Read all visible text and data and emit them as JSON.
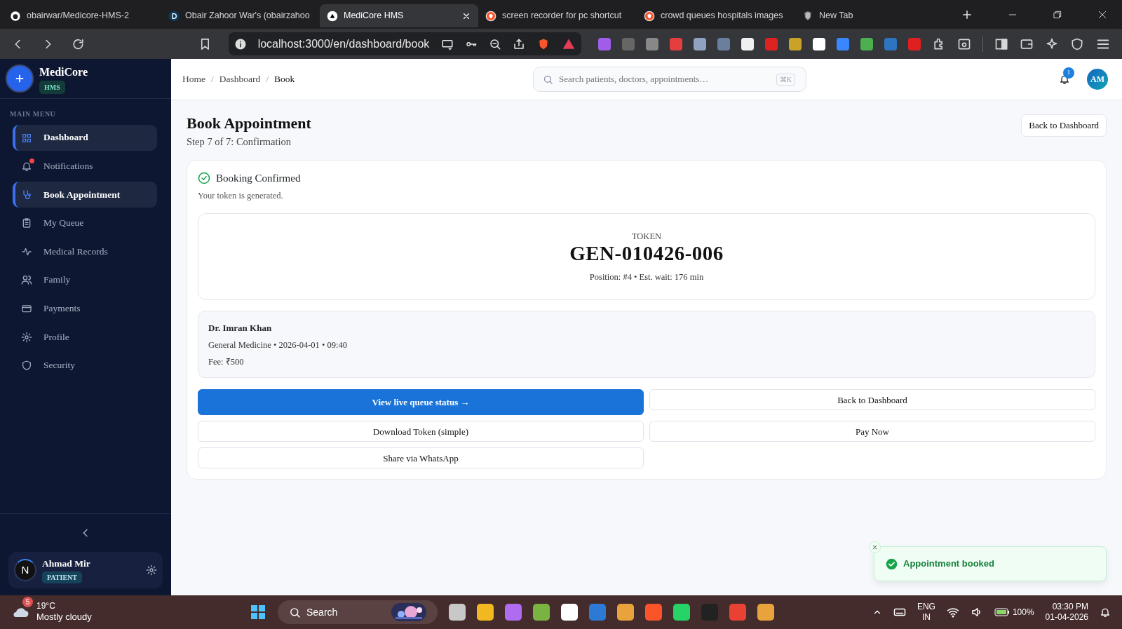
{
  "browser": {
    "tabs": [
      {
        "title": "obairwar/Medicore-HMS-2",
        "selected": false
      },
      {
        "title": "Obair Zahoor War's (obairzahoo",
        "selected": false
      },
      {
        "title": "MediCore HMS",
        "selected": true
      },
      {
        "title": "screen recorder for pc shortcut",
        "selected": false
      },
      {
        "title": "crowd queues hospitals images",
        "selected": false
      },
      {
        "title": "New Tab",
        "selected": false
      }
    ],
    "address": "localhost:3000/en/dashboard/book"
  },
  "sidebar": {
    "brand": "MediCore",
    "brand_badge": "HMS",
    "menu_heading": "MAIN MENU",
    "items": [
      {
        "label": "Dashboard",
        "selected": true,
        "dot": false
      },
      {
        "label": "Notifications",
        "selected": false,
        "dot": true
      },
      {
        "label": "Book Appointment",
        "selected": true,
        "dot": false
      },
      {
        "label": "My Queue",
        "selected": false,
        "dot": false
      },
      {
        "label": "Medical Records",
        "selected": false,
        "dot": false
      },
      {
        "label": "Family",
        "selected": false,
        "dot": false
      },
      {
        "label": "Payments",
        "selected": false,
        "dot": false
      },
      {
        "label": "Profile",
        "selected": false,
        "dot": false
      },
      {
        "label": "Security",
        "selected": false,
        "dot": false
      }
    ],
    "user": {
      "initial": "N",
      "name": "Ahmad Mir",
      "role": "PATIENT"
    }
  },
  "header": {
    "breadcrumbs": [
      "Home",
      "Dashboard",
      "Book"
    ],
    "breadcrumb_separator": "/",
    "search": {
      "placeholder": "Search patients, doctors, appointments…"
    },
    "shortcut": "⌘K",
    "notification_count": "1",
    "avatar": "AM"
  },
  "page": {
    "title": "Book Appointment",
    "subtitle": "Step 7 of 7: Confirmation",
    "back_button": "Back to Dashboard"
  },
  "confirmation": {
    "title": "Booking Confirmed",
    "text": "Your token is generated.",
    "token": {
      "label": "TOKEN",
      "code": "GEN-010426-006",
      "meta": "Position: #4 • Est. wait: 176 min"
    },
    "doctor": {
      "name": "Dr. Imran Khan",
      "details": "General Medicine • 2026-04-01 • 09:40",
      "fee": "Fee: ₹500"
    },
    "actions": [
      {
        "label": "View live queue status →",
        "kind": "primary"
      },
      {
        "label": "Back to Dashboard",
        "kind": "outline"
      },
      {
        "label": "Download Token (simple)",
        "kind": "outline"
      },
      {
        "label": "Pay Now",
        "kind": "outline"
      },
      {
        "label": "Share via WhatsApp",
        "kind": "outline"
      }
    ]
  },
  "toast": {
    "message": "Appointment booked"
  },
  "taskbar": {
    "weather": {
      "badge": "5",
      "temperature": "19°C",
      "condition": "Mostly cloudy"
    },
    "search": "Search",
    "language": [
      "ENG",
      "IN"
    ],
    "battery": "100%",
    "time": "03:30 PM",
    "date": "01-04-2026"
  }
}
